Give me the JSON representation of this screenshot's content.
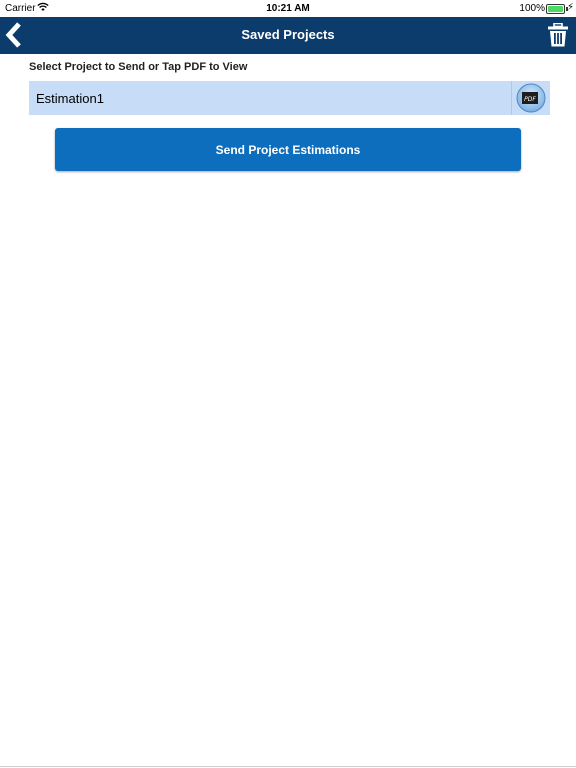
{
  "status_bar": {
    "carrier": "Carrier",
    "time": "10:21 AM",
    "battery": "100%",
    "battery_level": 1.0
  },
  "nav": {
    "title": "Saved Projects",
    "back_icon": "chevron-left-icon",
    "trash_icon": "trash-icon"
  },
  "main": {
    "instruction": "Select Project to Send or Tap PDF to View",
    "projects": [
      {
        "name": "Estimation1",
        "pdf_label": "PDF"
      }
    ],
    "send_button": "Send Project Estimations"
  },
  "colors": {
    "nav_background": "#0c3c6c",
    "row_background": "#c6dcf7",
    "button_background": "#0d6ebe",
    "battery_fill": "#4cd964"
  }
}
